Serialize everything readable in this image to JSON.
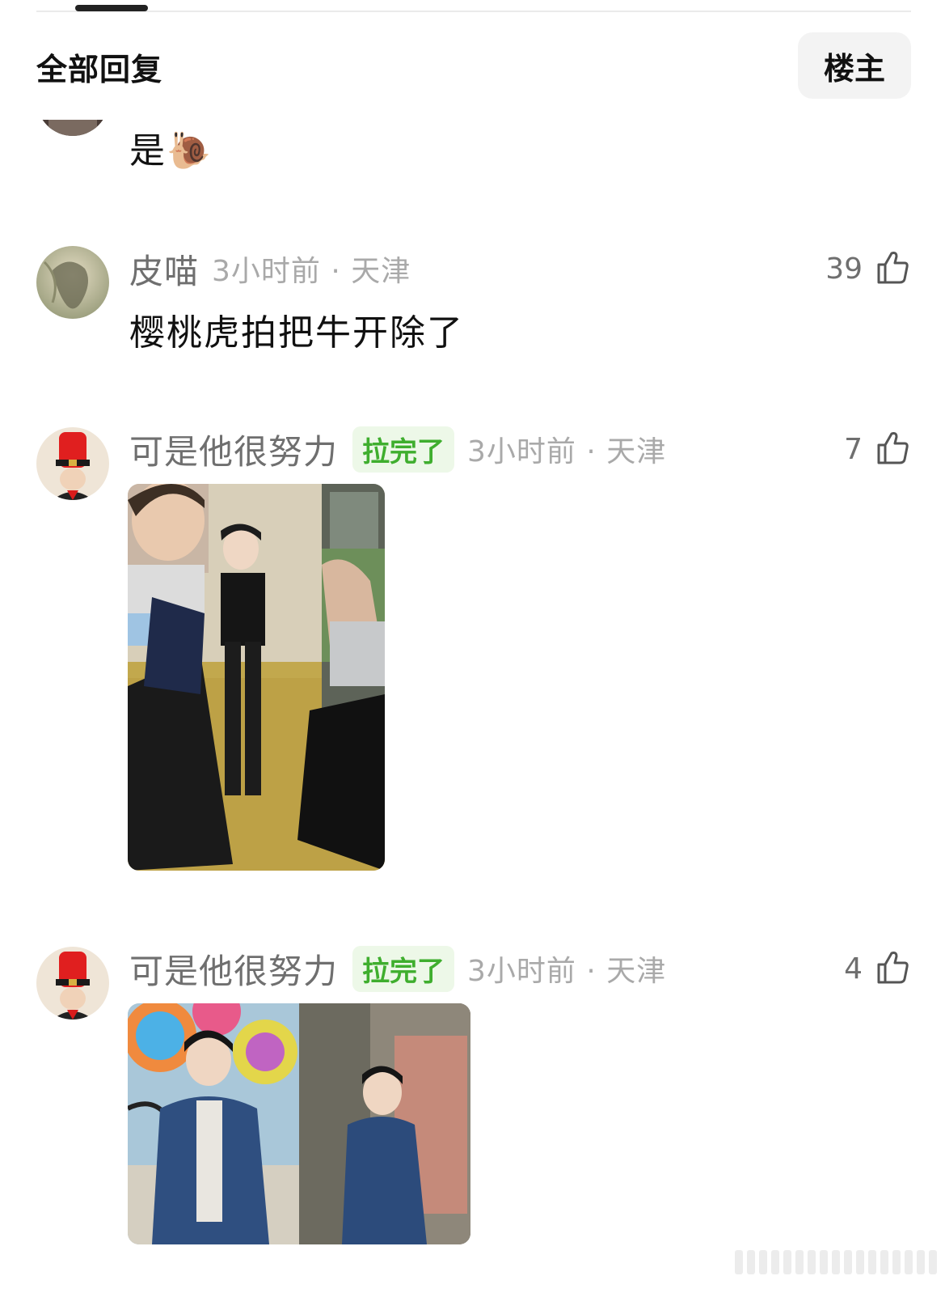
{
  "header": {
    "title": "全部回复",
    "op_button": "楼主"
  },
  "comments": [
    {
      "text": "是🐌",
      "avatar": "partial-avatar"
    },
    {
      "username": "皮喵",
      "time": "3小时前 · 天津",
      "likes": "39",
      "text": "樱桃虎拍把牛开除了",
      "avatar": "painting-avatar"
    },
    {
      "username": "可是他很努力",
      "badge": "拉完了",
      "time": "3小时前 · 天津",
      "likes": "7",
      "attachment": "dance-photo",
      "avatar": "red-hat-avatar"
    },
    {
      "username": "可是他很努力",
      "badge": "拉完了",
      "time": "3小时前 · 天津",
      "likes": "4",
      "attachment": "denim-jacket-photo",
      "avatar": "red-hat-avatar"
    }
  ],
  "colors": {
    "badge_bg": "#edf8e8",
    "badge_text": "#3fae2e",
    "meta_text": "#a9a9a9",
    "username": "#6f6f6f"
  }
}
